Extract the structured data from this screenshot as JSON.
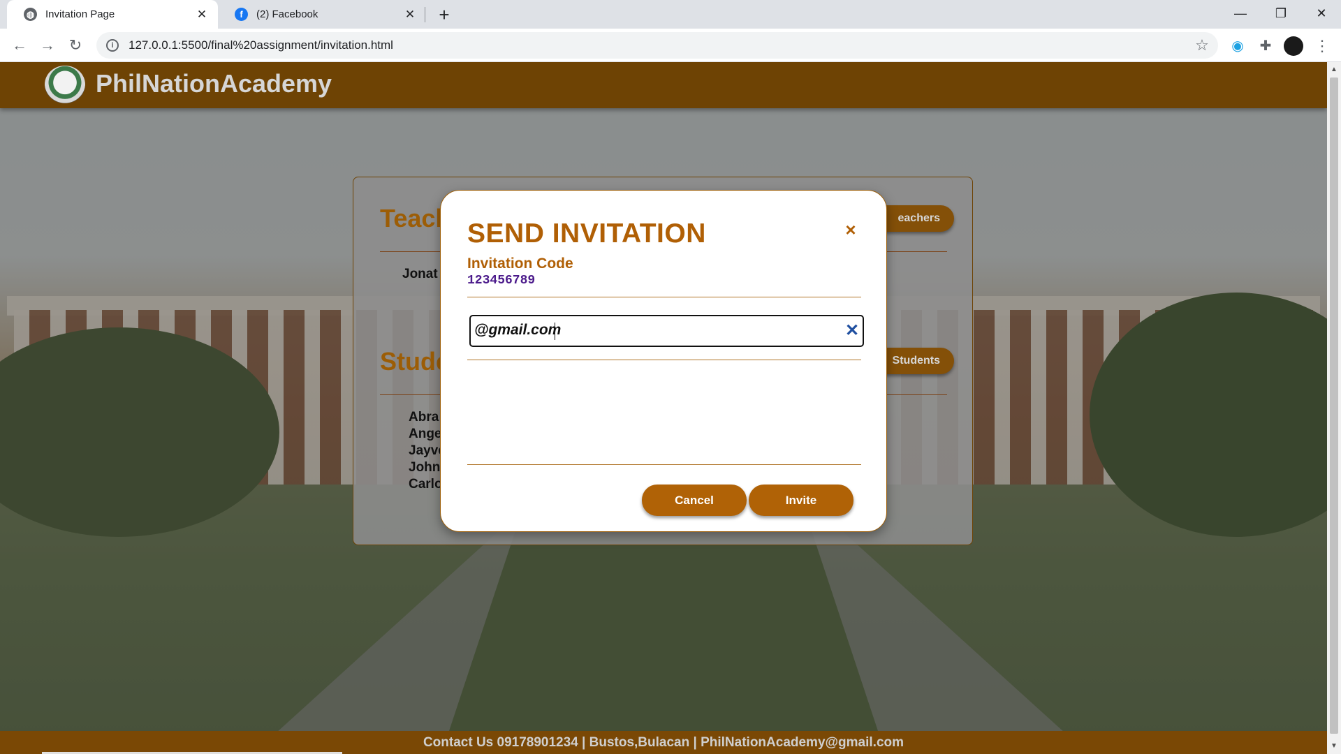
{
  "browser": {
    "tabs": [
      {
        "title": "Invitation Page",
        "icon": "globe-icon",
        "active": true
      },
      {
        "title": "(2) Facebook",
        "icon": "facebook-icon",
        "active": false
      }
    ],
    "new_tab": "+",
    "url": "127.0.0.1:5500/final%20assignment/invitation.html",
    "window_controls": {
      "minimize": "—",
      "restore": "❐",
      "close": "✕"
    }
  },
  "site": {
    "title": "PhilNationAcademy",
    "logo_icon": "academy-seal-logo",
    "brand_color": "#6e4304"
  },
  "card": {
    "teachers_heading": "Teach",
    "teachers_button": "eachers",
    "teacher_name": "Jonat",
    "students_heading": "Stude",
    "students_button": "Students",
    "students": [
      "Abra",
      "Ange",
      "Jayve",
      "John",
      "Carlo"
    ]
  },
  "modal": {
    "title": "SEND INVITATION",
    "close_icon": "×",
    "code_label": "Invitation Code",
    "code_value": "123456789",
    "email_value": "@gmail.com",
    "clear_icon": "✕",
    "cancel_label": "Cancel",
    "invite_label": "Invite",
    "accent_color": "#b05f05"
  },
  "footer": {
    "text": "Contact Us 09178901234 | Bustos,Bulacan | PhilNationAcademy@gmail.com"
  }
}
